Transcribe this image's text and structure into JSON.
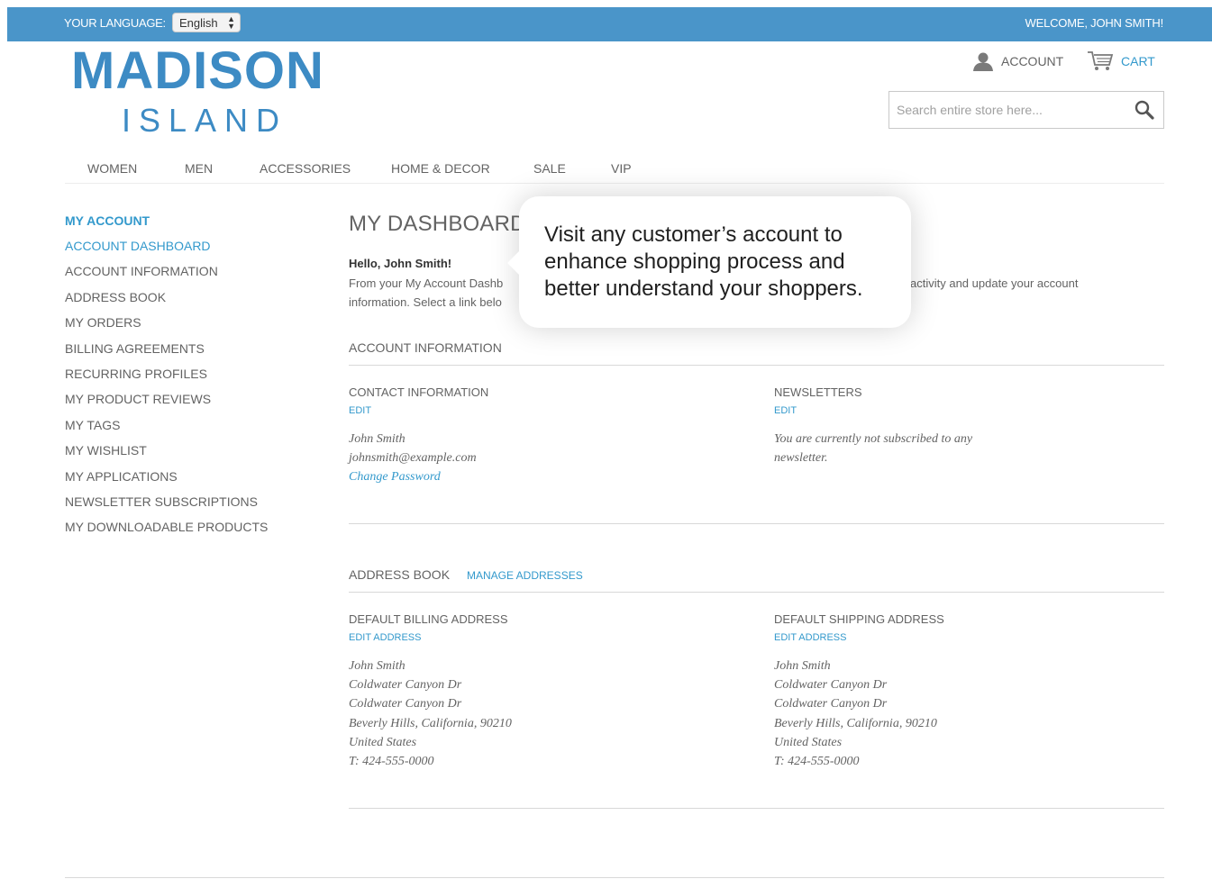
{
  "topbar": {
    "language_label": "YOUR LANGUAGE:",
    "language_value": "English",
    "welcome": "WELCOME, JOHN SMITH!"
  },
  "logo": {
    "main": "MADISON",
    "sub": "ISLAND"
  },
  "header": {
    "account_label": "ACCOUNT",
    "cart_label": "CART",
    "search_placeholder": "Search entire store here..."
  },
  "nav": [
    "WOMEN",
    "MEN",
    "ACCESSORIES",
    "HOME & DECOR",
    "SALE",
    "VIP"
  ],
  "sidebar": {
    "title": "MY ACCOUNT",
    "items": [
      "ACCOUNT DASHBOARD",
      "ACCOUNT INFORMATION",
      "ADDRESS BOOK",
      "MY ORDERS",
      "BILLING AGREEMENTS",
      "RECURRING PROFILES",
      "MY PRODUCT REVIEWS",
      "MY TAGS",
      "MY WISHLIST",
      "MY APPLICATIONS",
      "NEWSLETTER SUBSCRIPTIONS",
      "MY DOWNLOADABLE PRODUCTS"
    ],
    "active_index": 0
  },
  "dashboard": {
    "title": "MY DASHBOARD",
    "hello": "Hello, John Smith!",
    "intro_line1": "From your My Account Dashb",
    "intro_line2": "information. Select a link belo",
    "intro_right": "activity and update your account"
  },
  "account_info": {
    "title": "ACCOUNT INFORMATION",
    "contact": {
      "title": "CONTACT INFORMATION",
      "edit": "EDIT",
      "name": "John Smith",
      "email": "johnsmith@example.com",
      "change_password": "Change Password"
    },
    "newsletters": {
      "title": "NEWSLETTERS",
      "edit": "EDIT",
      "line1": "You are currently not subscribed to any",
      "line2": "newsletter."
    }
  },
  "address_book": {
    "title": "ADDRESS BOOK",
    "manage": "MANAGE ADDRESSES",
    "billing": {
      "title": "DEFAULT BILLING ADDRESS",
      "edit": "EDIT ADDRESS",
      "lines": [
        "John Smith",
        "Coldwater Canyon Dr",
        "Coldwater Canyon Dr",
        "Beverly Hills, California, 90210",
        "United States",
        "T: 424-555-0000"
      ]
    },
    "shipping": {
      "title": "DEFAULT SHIPPING ADDRESS",
      "edit": "EDIT ADDRESS",
      "lines": [
        "John Smith",
        "Coldwater Canyon Dr",
        "Coldwater Canyon Dr",
        "Beverly Hills, California, 90210",
        "United States",
        "T: 424-555-0000"
      ]
    }
  },
  "callout": {
    "lines": [
      "Visit any customer’s account to",
      "enhance shopping process and",
      "better understand your shoppers."
    ]
  },
  "colors": {
    "topbar": "#4a95c9",
    "brand_blue": "#3d8bc4",
    "link_blue": "#3399cc",
    "text_gray": "#636363"
  },
  "icons": {
    "account": "user-icon",
    "cart": "cart-icon",
    "search": "search-icon",
    "select": "select-arrows-icon"
  }
}
